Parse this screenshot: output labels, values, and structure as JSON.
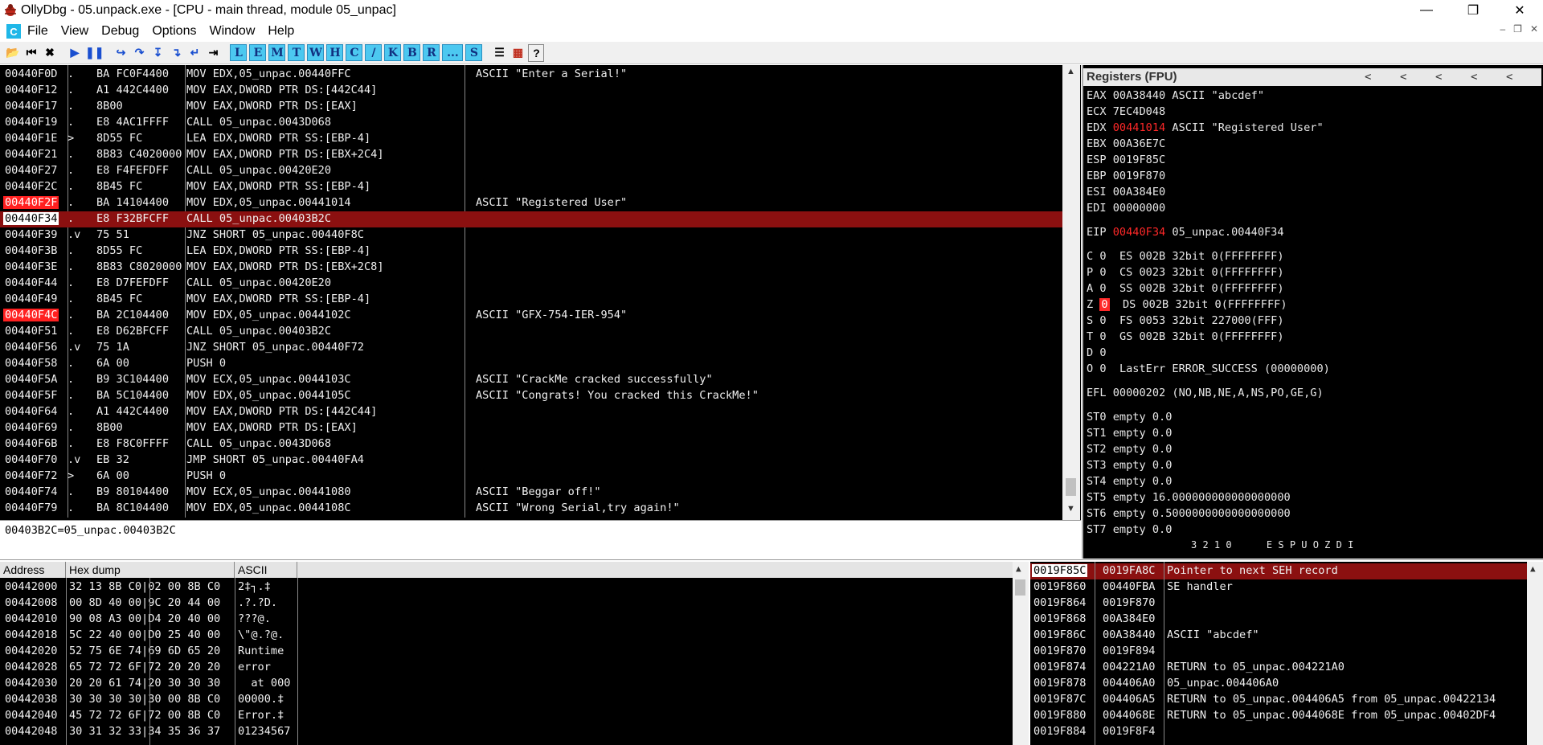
{
  "window": {
    "title": "OllyDbg - 05.unpack.exe - [CPU - main thread, module 05_unpac]"
  },
  "menu": [
    "File",
    "View",
    "Debug",
    "Options",
    "Window",
    "Help"
  ],
  "toolbar_letters": [
    "L",
    "E",
    "M",
    "T",
    "W",
    "H",
    "C",
    "/",
    "K",
    "B",
    "R",
    "...",
    "S"
  ],
  "disasm": [
    {
      "addr": "00440F0D",
      "mark": ".",
      "hex": "BA FC0F4400",
      "dis": "MOV EDX,05_unpac.00440FFC",
      "com": "ASCII \"Enter a Serial!\"",
      "style": ""
    },
    {
      "addr": "00440F12",
      "mark": ".",
      "hex": "A1 442C4400",
      "dis": "MOV EAX,DWORD PTR DS:[442C44]",
      "com": "",
      "style": ""
    },
    {
      "addr": "00440F17",
      "mark": ".",
      "hex": "8B00",
      "dis": "MOV EAX,DWORD PTR DS:[EAX]",
      "com": "",
      "style": ""
    },
    {
      "addr": "00440F19",
      "mark": ".",
      "hex": "E8 4AC1FFFF",
      "dis": "CALL 05_unpac.0043D068",
      "com": "",
      "style": ""
    },
    {
      "addr": "00440F1E",
      "mark": ">",
      "hex": "8D55 FC",
      "dis": "LEA EDX,DWORD PTR SS:[EBP-4]",
      "com": "",
      "style": ""
    },
    {
      "addr": "00440F21",
      "mark": ".",
      "hex": "8B83 C4020000",
      "dis": "MOV EAX,DWORD PTR DS:[EBX+2C4]",
      "com": "",
      "style": ""
    },
    {
      "addr": "00440F27",
      "mark": ".",
      "hex": "E8 F4FEFDFF",
      "dis": "CALL 05_unpac.00420E20",
      "com": "",
      "style": ""
    },
    {
      "addr": "00440F2C",
      "mark": ".",
      "hex": "8B45 FC",
      "dis": "MOV EAX,DWORD PTR SS:[EBP-4]",
      "com": "",
      "style": ""
    },
    {
      "addr": "00440F2F",
      "mark": ".",
      "hex": "BA 14104400",
      "dis": "MOV EDX,05_unpac.00441014",
      "com": "ASCII \"Registered User\"",
      "style": "bp"
    },
    {
      "addr": "00440F34",
      "mark": ".",
      "hex": "E8 F32BFCFF",
      "dis": "CALL 05_unpac.00403B2C",
      "com": "",
      "style": "cur"
    },
    {
      "addr": "00440F39",
      "mark": ".v",
      "hex": "75 51",
      "dis": "JNZ SHORT 05_unpac.00440F8C",
      "com": "",
      "style": ""
    },
    {
      "addr": "00440F3B",
      "mark": ".",
      "hex": "8D55 FC",
      "dis": "LEA EDX,DWORD PTR SS:[EBP-4]",
      "com": "",
      "style": ""
    },
    {
      "addr": "00440F3E",
      "mark": ".",
      "hex": "8B83 C8020000",
      "dis": "MOV EAX,DWORD PTR DS:[EBX+2C8]",
      "com": "",
      "style": ""
    },
    {
      "addr": "00440F44",
      "mark": ".",
      "hex": "E8 D7FEFDFF",
      "dis": "CALL 05_unpac.00420E20",
      "com": "",
      "style": ""
    },
    {
      "addr": "00440F49",
      "mark": ".",
      "hex": "8B45 FC",
      "dis": "MOV EAX,DWORD PTR SS:[EBP-4]",
      "com": "",
      "style": ""
    },
    {
      "addr": "00440F4C",
      "mark": ".",
      "hex": "BA 2C104400",
      "dis": "MOV EDX,05_unpac.0044102C",
      "com": "ASCII \"GFX-754-IER-954\"",
      "style": "bp"
    },
    {
      "addr": "00440F51",
      "mark": ".",
      "hex": "E8 D62BFCFF",
      "dis": "CALL 05_unpac.00403B2C",
      "com": "",
      "style": ""
    },
    {
      "addr": "00440F56",
      "mark": ".v",
      "hex": "75 1A",
      "dis": "JNZ SHORT 05_unpac.00440F72",
      "com": "",
      "style": ""
    },
    {
      "addr": "00440F58",
      "mark": ".",
      "hex": "6A 00",
      "dis": "PUSH 0",
      "com": "",
      "style": ""
    },
    {
      "addr": "00440F5A",
      "mark": ".",
      "hex": "B9 3C104400",
      "dis": "MOV ECX,05_unpac.0044103C",
      "com": "ASCII \"CrackMe cracked successfully\"",
      "style": ""
    },
    {
      "addr": "00440F5F",
      "mark": ".",
      "hex": "BA 5C104400",
      "dis": "MOV EDX,05_unpac.0044105C",
      "com": "ASCII \"Congrats! You cracked this CrackMe!\"",
      "style": ""
    },
    {
      "addr": "00440F64",
      "mark": ".",
      "hex": "A1 442C4400",
      "dis": "MOV EAX,DWORD PTR DS:[442C44]",
      "com": "",
      "style": ""
    },
    {
      "addr": "00440F69",
      "mark": ".",
      "hex": "8B00",
      "dis": "MOV EAX,DWORD PTR DS:[EAX]",
      "com": "",
      "style": ""
    },
    {
      "addr": "00440F6B",
      "mark": ".",
      "hex": "E8 F8C0FFFF",
      "dis": "CALL 05_unpac.0043D068",
      "com": "",
      "style": ""
    },
    {
      "addr": "00440F70",
      "mark": ".v",
      "hex": "EB 32",
      "dis": "JMP SHORT 05_unpac.00440FA4",
      "com": "",
      "style": ""
    },
    {
      "addr": "00440F72",
      "mark": ">",
      "hex": "6A 00",
      "dis": "PUSH 0",
      "com": "",
      "style": ""
    },
    {
      "addr": "00440F74",
      "mark": ".",
      "hex": "B9 80104400",
      "dis": "MOV ECX,05_unpac.00441080",
      "com": "ASCII \"Beggar off!\"",
      "style": ""
    },
    {
      "addr": "00440F79",
      "mark": ".",
      "hex": "BA 8C104400",
      "dis": "MOV EDX,05_unpac.0044108C",
      "com": "ASCII \"Wrong Serial,try again!\"",
      "style": ""
    }
  ],
  "info_line": "00403B2C=05_unpac.00403B2C",
  "registers": {
    "title": "Registers (FPU)",
    "lines": [
      {
        "name": "EAX",
        "val": "00A38440",
        "extra": "ASCII \"abcdef\"",
        "red": false
      },
      {
        "name": "ECX",
        "val": "7EC4D048",
        "extra": "",
        "red": false
      },
      {
        "name": "EDX",
        "val": "00441014",
        "extra": "ASCII \"Registered User\"",
        "red": true
      },
      {
        "name": "EBX",
        "val": "00A36E7C",
        "extra": "",
        "red": false
      },
      {
        "name": "ESP",
        "val": "0019F85C",
        "extra": "",
        "red": false
      },
      {
        "name": "EBP",
        "val": "0019F870",
        "extra": "",
        "red": false
      },
      {
        "name": "ESI",
        "val": "00A384E0",
        "extra": "",
        "red": false
      },
      {
        "name": "EDI",
        "val": "00000000",
        "extra": "",
        "red": false
      }
    ],
    "eip": {
      "name": "EIP",
      "val": "00440F34",
      "extra": "05_unpac.00440F34"
    },
    "flags": [
      {
        "f": "C",
        "v": "0",
        "seg": "ES 002B 32bit 0(FFFFFFFF)"
      },
      {
        "f": "P",
        "v": "0",
        "seg": "CS 0023 32bit 0(FFFFFFFF)"
      },
      {
        "f": "A",
        "v": "0",
        "seg": "SS 002B 32bit 0(FFFFFFFF)"
      },
      {
        "f": "Z",
        "v": "0",
        "seg": "DS 002B 32bit 0(FFFFFFFF)"
      },
      {
        "f": "S",
        "v": "0",
        "seg": "FS 0053 32bit 227000(FFF)"
      },
      {
        "f": "T",
        "v": "0",
        "seg": "GS 002B 32bit 0(FFFFFFFF)"
      },
      {
        "f": "D",
        "v": "0",
        "seg": ""
      },
      {
        "f": "O",
        "v": "0",
        "seg": "LastErr ERROR_SUCCESS (00000000)"
      }
    ],
    "efl": "EFL 00000202 (NO,NB,NE,A,NS,PO,GE,G)",
    "fpu": [
      "ST0 empty 0.0",
      "ST1 empty 0.0",
      "ST2 empty 0.0",
      "ST3 empty 0.0",
      "ST4 empty 0.0",
      "ST5 empty 16.000000000000000000",
      "ST6 empty 0.5000000000000000000",
      "ST7 empty 0.0"
    ],
    "fpu_bits": "3 2 1 0      E S P U O Z D I"
  },
  "dump": {
    "headers": [
      "Address",
      "Hex dump",
      "ASCII"
    ],
    "rows": [
      {
        "addr": "00442000",
        "hex": "32 13 8B C0|02 00 8B C0",
        "ascii": "2‡┐.‡"
      },
      {
        "addr": "00442008",
        "hex": "00 8D 40 00|9C 20 44 00",
        "ascii": ".?.?D."
      },
      {
        "addr": "00442010",
        "hex": "90 08 A3 00|D4 20 40 00",
        "ascii": "???@."
      },
      {
        "addr": "00442018",
        "hex": "5C 22 40 00|D0 25 40 00",
        "ascii": "\\\"@.?@."
      },
      {
        "addr": "00442020",
        "hex": "52 75 6E 74|69 6D 65 20",
        "ascii": "Runtime "
      },
      {
        "addr": "00442028",
        "hex": "65 72 72 6F|72 20 20 20",
        "ascii": "error   "
      },
      {
        "addr": "00442030",
        "hex": "20 20 61 74|20 30 30 30",
        "ascii": "  at 000"
      },
      {
        "addr": "00442038",
        "hex": "30 30 30 30|30 00 8B C0",
        "ascii": "00000.‡"
      },
      {
        "addr": "00442040",
        "hex": "45 72 72 6F|72 00 8B C0",
        "ascii": "Error.‡"
      },
      {
        "addr": "00442048",
        "hex": "30 31 32 33|34 35 36 37",
        "ascii": "01234567"
      }
    ]
  },
  "stack": [
    {
      "addr": "0019F85C",
      "val": "0019FA8C",
      "com": "Pointer to next SEH record",
      "sel": true
    },
    {
      "addr": "0019F860",
      "val": "00440FBA",
      "com": "SE handler",
      "sel": false
    },
    {
      "addr": "0019F864",
      "val": "0019F870",
      "com": "",
      "sel": false
    },
    {
      "addr": "0019F868",
      "val": "00A384E0",
      "com": "",
      "sel": false
    },
    {
      "addr": "0019F86C",
      "val": "00A38440",
      "com": "ASCII \"abcdef\"",
      "sel": false
    },
    {
      "addr": "0019F870",
      "val": "0019F894",
      "com": "",
      "sel": false
    },
    {
      "addr": "0019F874",
      "val": "004221A0",
      "com": "RETURN to 05_unpac.004221A0",
      "sel": false
    },
    {
      "addr": "0019F878",
      "val": "004406A0",
      "com": "05_unpac.004406A0",
      "sel": false
    },
    {
      "addr": "0019F87C",
      "val": "004406A5",
      "com": "RETURN to 05_unpac.004406A5 from 05_unpac.00422134",
      "sel": false
    },
    {
      "addr": "0019F880",
      "val": "0044068E",
      "com": "RETURN to 05_unpac.0044068E from 05_unpac.00402DF4",
      "sel": false
    },
    {
      "addr": "0019F884",
      "val": "0019F8F4",
      "com": "",
      "sel": false
    }
  ]
}
